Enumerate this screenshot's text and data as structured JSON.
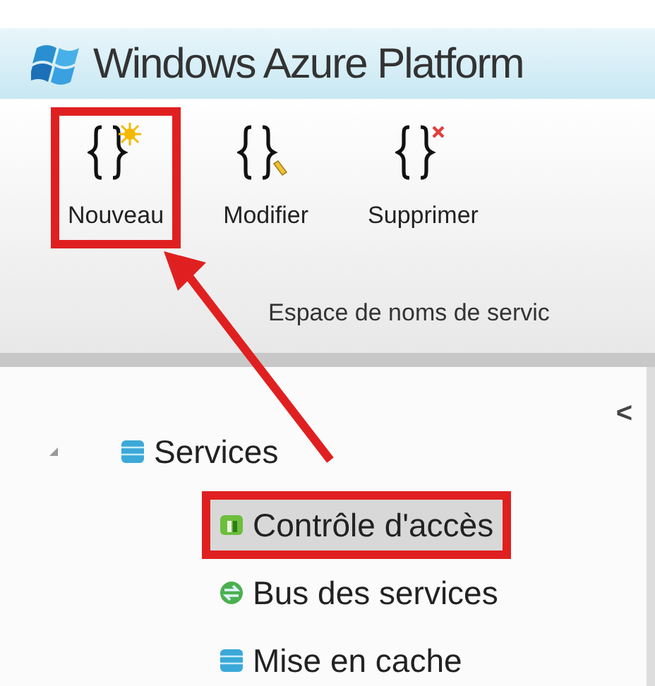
{
  "header": {
    "title": "Windows Azure Platform"
  },
  "ribbon": {
    "buttons": [
      {
        "label": "Nouveau",
        "kind": "new",
        "highlighted": true
      },
      {
        "label": "Modifier",
        "kind": "edit",
        "highlighted": false
      },
      {
        "label": "Supprimer",
        "kind": "delete",
        "highlighted": false
      }
    ],
    "group_label": "Espace de noms de servic"
  },
  "tree": {
    "collapse": "<",
    "items": [
      {
        "label": "Services",
        "kind": "database",
        "expanded": true,
        "selected": false,
        "highlighted": false,
        "children": [
          {
            "label": "Contrôle d'accès",
            "kind": "access",
            "selected": true,
            "highlighted": true
          },
          {
            "label": "Bus des services",
            "kind": "bus",
            "selected": false,
            "highlighted": false
          },
          {
            "label": "Mise en cache",
            "kind": "database",
            "selected": false,
            "highlighted": false
          }
        ]
      }
    ]
  }
}
